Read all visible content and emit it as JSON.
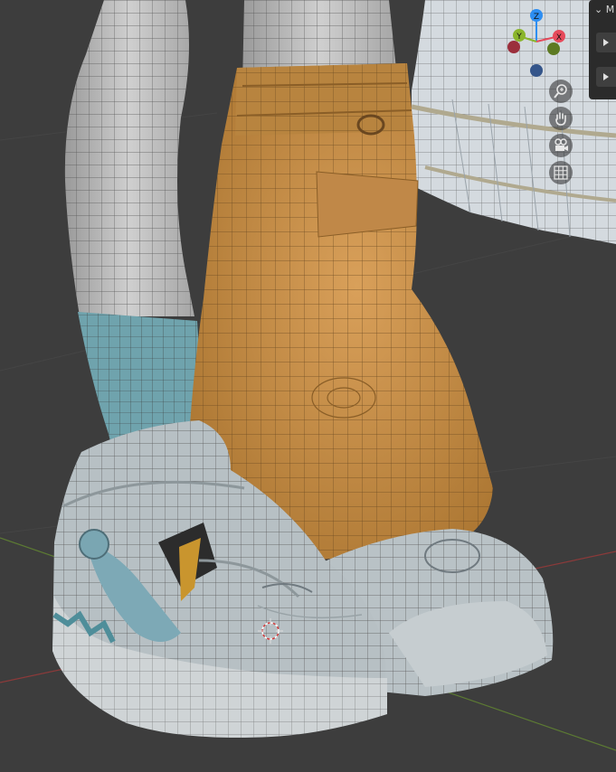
{
  "gizmo": {
    "axis_z": "Z",
    "axis_y": "Y",
    "axis_x": "X",
    "colors": {
      "x": "#e64a5b",
      "y": "#8ab52c",
      "z": "#2d8ef2"
    }
  },
  "nav_buttons": [
    {
      "name": "zoom-icon"
    },
    {
      "name": "hand-pan-icon"
    },
    {
      "name": "camera-icon"
    },
    {
      "name": "grid-icon"
    }
  ],
  "side_panel": {
    "header": "M"
  },
  "viewport": {
    "grid_axis_x_color": "#8b3a3a",
    "grid_axis_y_color": "#5c7a33",
    "background": "#3d3d3d",
    "mesh_colors": {
      "boot": "#c98f48",
      "sock": "#6fa3ad",
      "skin": "#bdbdbd",
      "shoe": "#b7c0c4",
      "skirt": "#dfe3e6"
    }
  }
}
